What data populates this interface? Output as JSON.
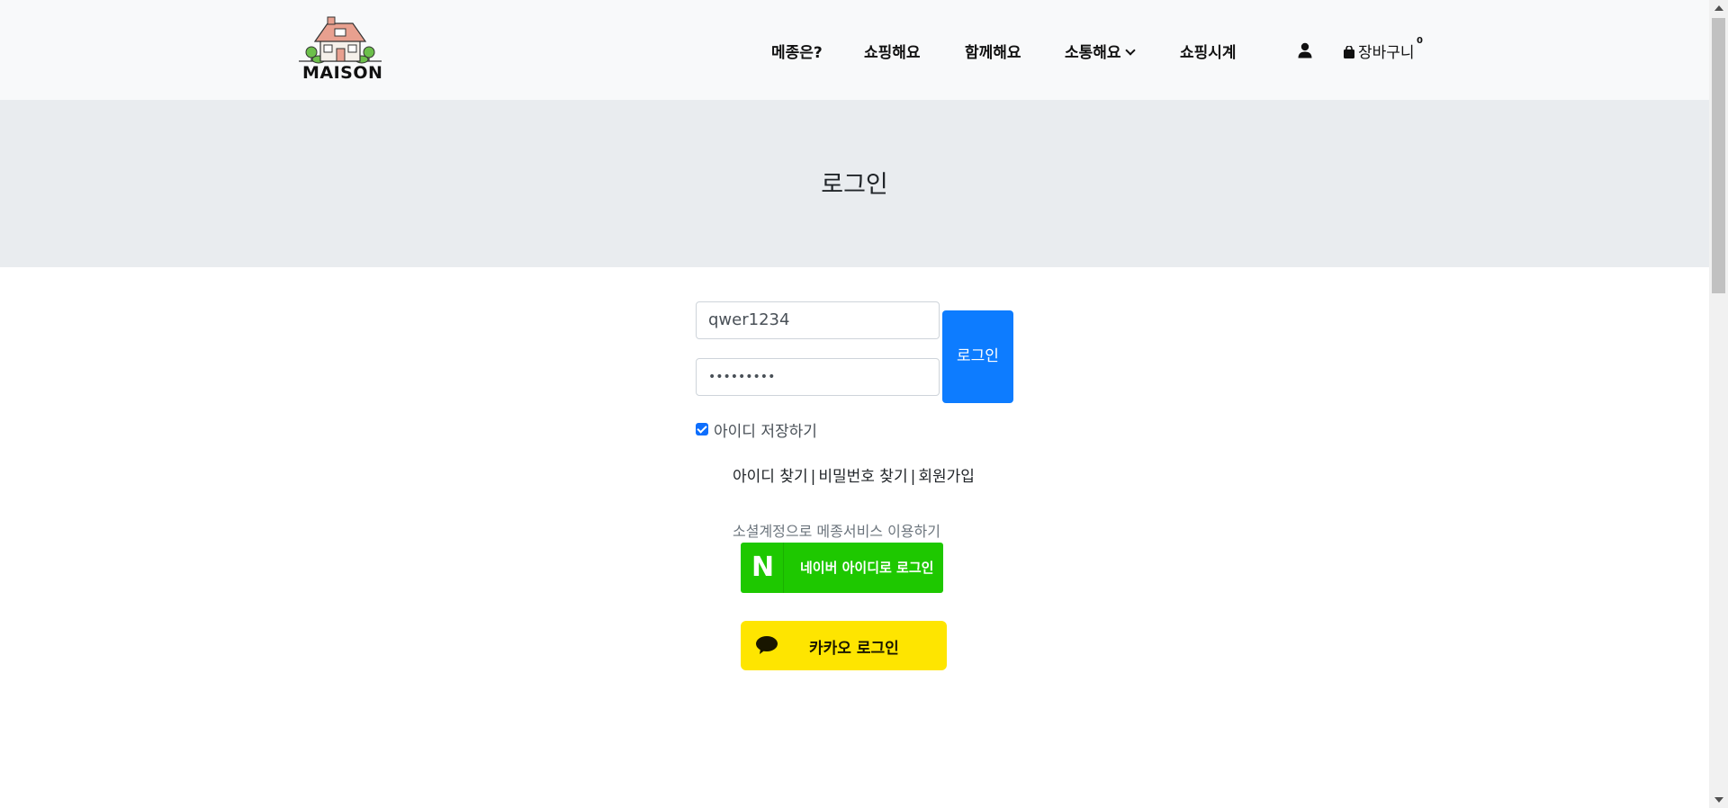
{
  "header": {
    "logo_text": "MAISON",
    "nav": [
      {
        "label": "메종은?"
      },
      {
        "label": "쇼핑해요"
      },
      {
        "label": "함께해요"
      },
      {
        "label": "소통해요"
      },
      {
        "label": "쇼핑시계"
      }
    ],
    "cart_label": "장바구니",
    "cart_count": "0"
  },
  "banner": {
    "title": "로그인"
  },
  "form": {
    "username_value": "qwer1234",
    "password_value": "•••••••••",
    "login_label": "로그인",
    "remember_label": "아이디 저장하기",
    "remember_checked": true,
    "find_id_label": "아이디 찾기",
    "find_pw_label": "비밀번호 찾기",
    "signup_label": "회원가입",
    "separator": "|"
  },
  "social": {
    "label": "소셜계정으로 메종서비스 이용하기",
    "naver_letter": "N",
    "naver_label": "네이버 아이디로 로그인",
    "kakao_label": "카카오 로그인"
  },
  "colors": {
    "primary_button": "#0d7cff",
    "naver_green": "#1ec800",
    "kakao_yellow": "#fee500",
    "banner_bg": "#e9ecef",
    "header_bg": "#f8f9fa"
  }
}
